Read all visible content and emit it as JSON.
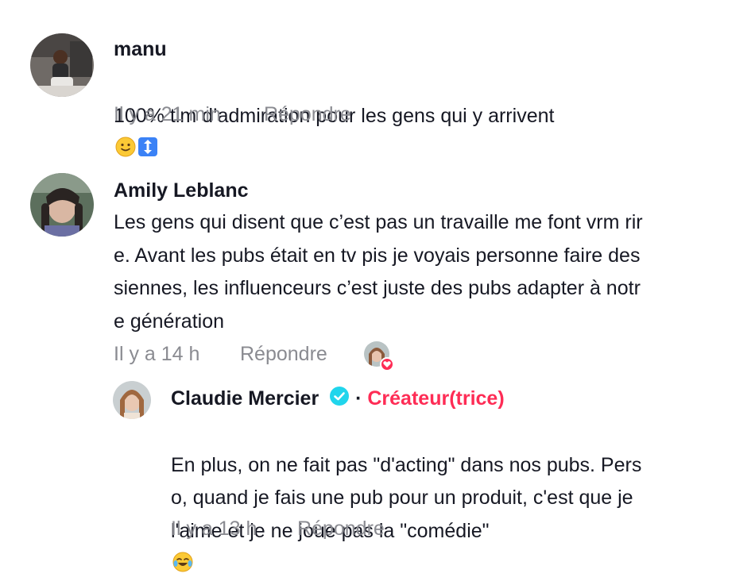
{
  "comments": [
    {
      "username": "manu",
      "text": "100% tlm d’admiration pour les gens qui y arrivent",
      "emojis": [
        "slightly-smiling-face",
        "up-down-arrow"
      ],
      "time": "Il y a 21 min",
      "reply_label": "Répondre"
    },
    {
      "username": "Amily Leblanc",
      "text": "Les gens qui disent que c’est pas un travaille me font vrm rir\ne. Avant les pubs était en tv pis je voyais personne faire des\nsiennes, les influenceurs c’est juste des pubs adapter à notr\ne génération",
      "time": "Il y a 14 h",
      "reply_label": "Répondre",
      "liked_by_creator": true
    }
  ],
  "reply": {
    "username": "Claudie Mercier",
    "verified": true,
    "separator": "·",
    "creator_label": "Créateur(trice)",
    "text": "En plus, on ne fait pas \"d'acting\" dans nos pubs. Pers\no, quand je fais une pub pour un produit, c'est que je\nl'aime et je ne joue pas la \"comédie\"",
    "emoji": "face-with-tears-of-joy",
    "time": "Il y a 13 h",
    "reply_label": "Répondre"
  },
  "colors": {
    "text": "#161823",
    "muted": "#8a8b91",
    "creator": "#fe2c55",
    "verified": "#20d5ec"
  }
}
